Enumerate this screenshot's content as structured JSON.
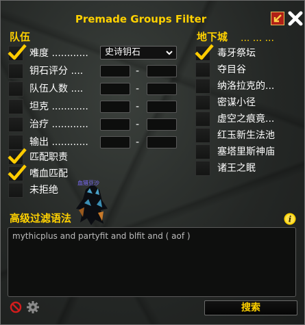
{
  "window": {
    "title": "Premade Groups Filter"
  },
  "party": {
    "title": "队伍",
    "difficulty": {
      "label": "难度",
      "dots": "............",
      "checked": true,
      "value": "史诗钥石"
    },
    "rows": [
      {
        "label": "钥石评分",
        "dots": "....",
        "checked": false,
        "min": "",
        "max": ""
      },
      {
        "label": "队伍人数",
        "dots": "....",
        "checked": false,
        "min": "",
        "max": ""
      },
      {
        "label": "坦克",
        "dots": "............",
        "checked": false,
        "min": "",
        "max": ""
      },
      {
        "label": "治疗",
        "dots": "............",
        "checked": false,
        "min": "",
        "max": ""
      },
      {
        "label": "输出",
        "dots": "............",
        "checked": false,
        "min": "",
        "max": ""
      }
    ],
    "range_separator": "-",
    "flags": [
      {
        "label": "匹配职责",
        "checked": true
      },
      {
        "label": "嗜血匹配",
        "checked": true
      },
      {
        "label": "未拒绝",
        "checked": false
      }
    ]
  },
  "dungeons": {
    "title": "地下城",
    "title_dots": "... ... ...",
    "items": [
      {
        "label": "毒牙祭坛",
        "checked": true
      },
      {
        "label": "夺目谷",
        "checked": false
      },
      {
        "label": "纳洛拉克的...",
        "checked": false
      },
      {
        "label": "密谋小径",
        "checked": false
      },
      {
        "label": "虚空之痕竟...",
        "checked": false
      },
      {
        "label": "红玉新生法池",
        "checked": false
      },
      {
        "label": "塞塔里斯神庙",
        "checked": false
      },
      {
        "label": "诸王之眠",
        "checked": false
      }
    ]
  },
  "advanced": {
    "title": "高级过滤语法",
    "expression": "mythicplus and partyfit and blfit and ( aof )"
  },
  "footer": {
    "search_label": "搜索"
  },
  "portrait": {
    "name": "血猎豆沙"
  },
  "colors": {
    "accent": "#ffd100",
    "check": "#ffcc00",
    "close_button": "#b02016"
  }
}
